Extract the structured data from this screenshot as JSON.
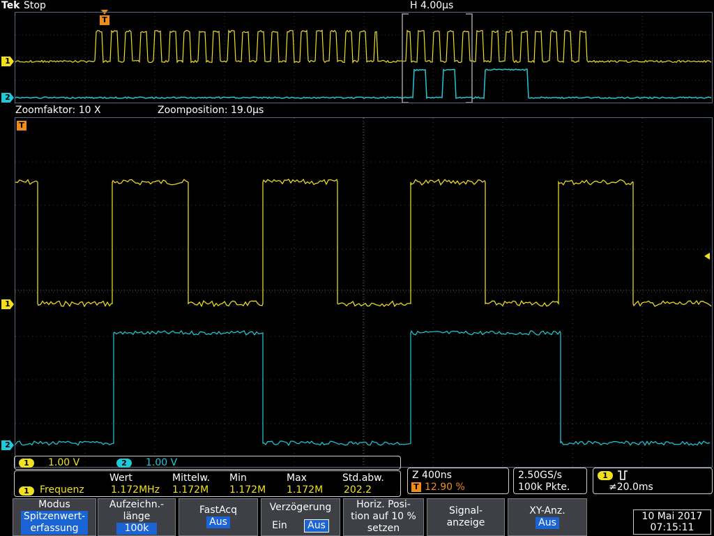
{
  "header": {
    "brand": "Tek",
    "run_state": "Stop",
    "horizontal": "H 4.00µs"
  },
  "zoom_info": {
    "factor": "Zoomfaktor: 10 X",
    "position": "Zoomposition: 19.0µs"
  },
  "markers": {
    "ch1": "1",
    "ch2": "2",
    "trigger": "T"
  },
  "channels": [
    {
      "id": "1",
      "scale": "1.00 V",
      "color": "#f0e020"
    },
    {
      "id": "2",
      "scale": "1.00 V",
      "color": "#20c8d8"
    }
  ],
  "measurement": {
    "channel": "1",
    "name": "Frequenz",
    "headers": [
      "Wert",
      "Mittelw.",
      "Min",
      "Max",
      "Std.abw."
    ],
    "values": [
      "1.172MHz",
      "1.172M",
      "1.172M",
      "1.172M",
      "202.2"
    ]
  },
  "timebase": {
    "zoom": "Z 400ns",
    "trigger_pos": "12.90 %"
  },
  "acquisition": {
    "rate": "2.50GS/s",
    "points": "100k Pkte."
  },
  "trigger": {
    "channel": "1",
    "slope_icon": "pulse-trigger-icon",
    "level": "≠20.0ms"
  },
  "buttons": {
    "modus": {
      "label": "Modus",
      "value": "Spitzenwert-\nerfassung"
    },
    "record": {
      "label": "Aufzeichn.-\nlänge",
      "value": "100k"
    },
    "fastacq": {
      "label": "FastAcq",
      "value": "Aus"
    },
    "delay": {
      "label": "Verzögerung",
      "on": "Ein",
      "off": "Aus"
    },
    "horizpos": {
      "label": "Horiz. Posi-\ntion auf 10 %\nsetzen"
    },
    "signal": {
      "label": "Signal-\nanzeige"
    },
    "xy": {
      "label": "XY-Anz.",
      "value": "Aus"
    }
  },
  "datetime": {
    "date": "10 Mai  2017",
    "time": "07:15:11"
  },
  "colors": {
    "ch1": "#f0e020",
    "ch2": "#20c8d8",
    "trigger": "#f08c1a",
    "highlight": "#1b64d6"
  }
}
